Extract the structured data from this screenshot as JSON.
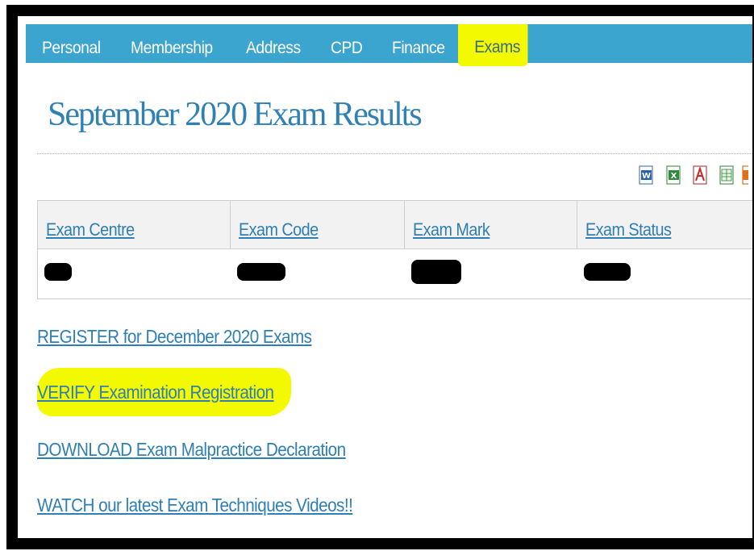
{
  "nav": {
    "tabs": [
      {
        "label": "Personal"
      },
      {
        "label": "Membership"
      },
      {
        "label": "Address"
      },
      {
        "label": "CPD"
      },
      {
        "label": "Finance"
      },
      {
        "label": "Exams",
        "active": true
      }
    ],
    "bar_color": "#3ba5cf"
  },
  "page": {
    "title": "September 2020 Exam Results"
  },
  "export_icons": [
    "word-icon",
    "excel-icon",
    "pdf-icon",
    "csv-icon",
    "xml-icon"
  ],
  "table": {
    "headers": [
      "Exam Centre",
      "Exam Code",
      "Exam Mark",
      "Exam Status"
    ]
  },
  "links": {
    "register": "REGISTER for December 2020 Exams",
    "verify": "VERIFY Examination Registration",
    "download": "DOWNLOAD Exam Malpractice Declaration",
    "watch": "WATCH our latest Exam Techniques Videos!!"
  },
  "colors": {
    "highlight": "#f3f900",
    "link": "#2f7fb5",
    "title": "#2f80b5"
  }
}
